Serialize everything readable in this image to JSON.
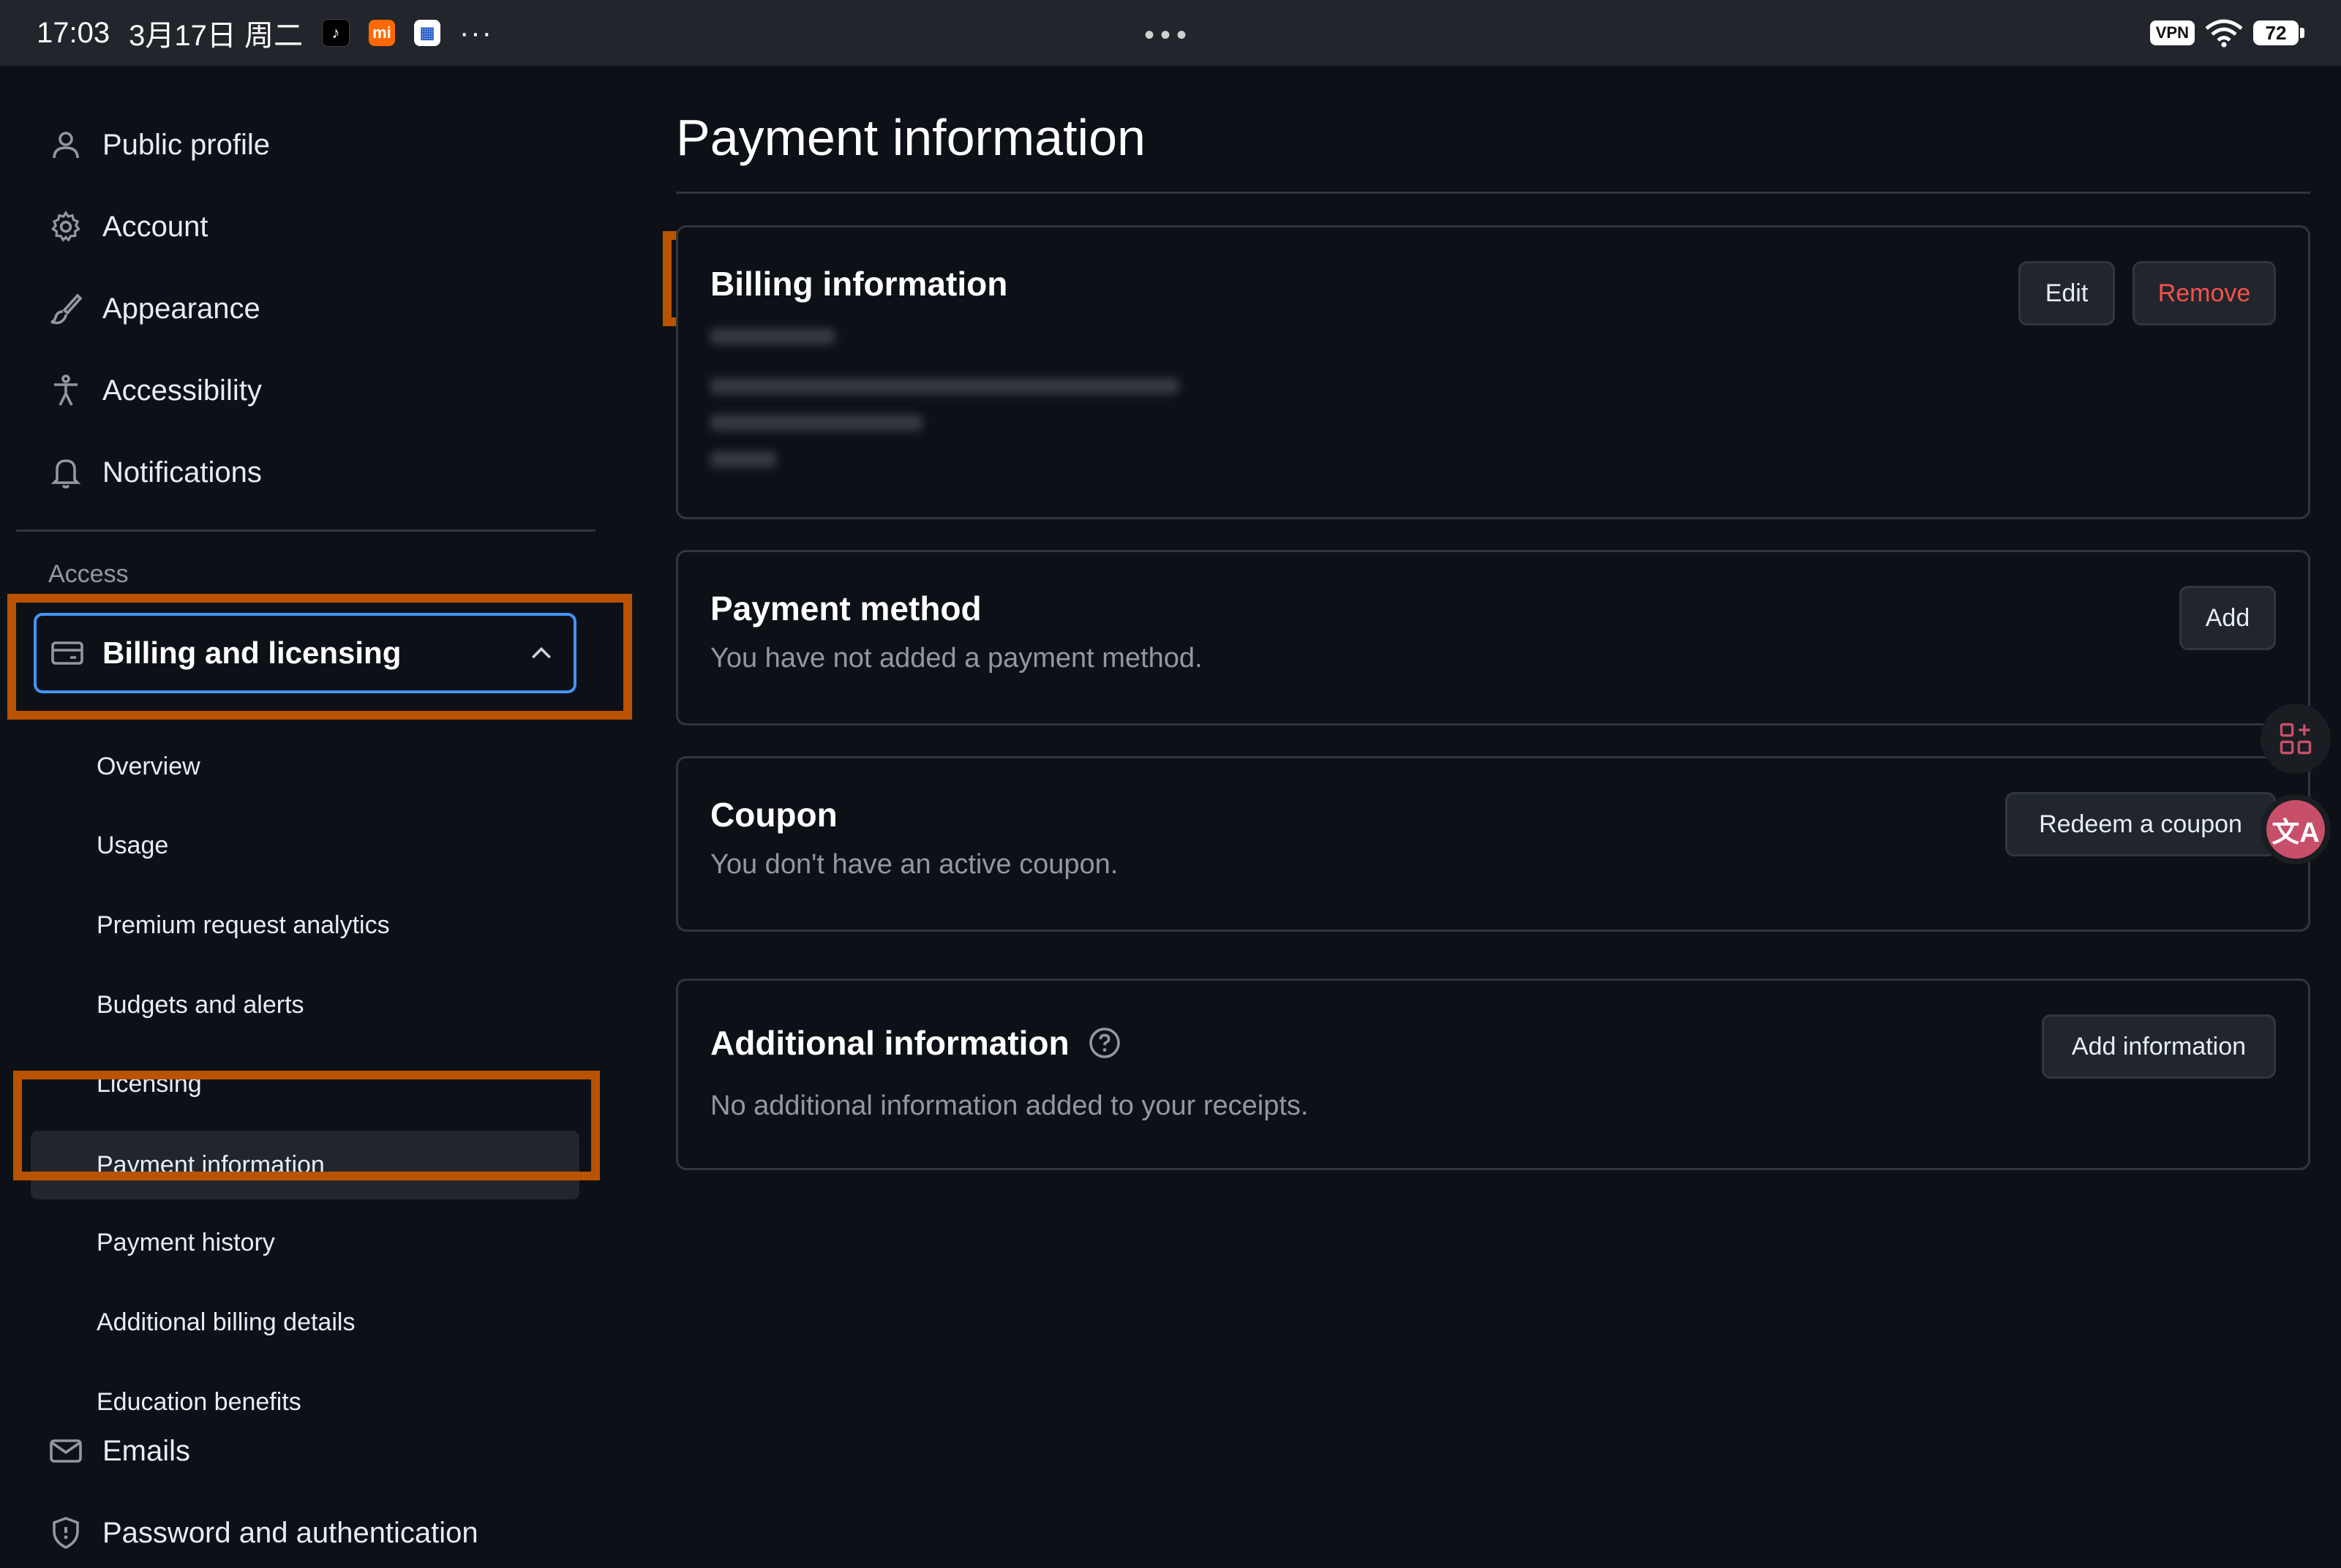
{
  "status_bar": {
    "time": "17:03",
    "date": "3月17日 周二",
    "app_mi_label": "mi",
    "more": "···",
    "center_dots": "•••",
    "vpn": "VPN",
    "battery": "72"
  },
  "sidebar": {
    "items": [
      {
        "label": "Public profile",
        "icon": "person-icon"
      },
      {
        "label": "Account",
        "icon": "gear-icon"
      },
      {
        "label": "Appearance",
        "icon": "paintbrush-icon"
      },
      {
        "label": "Accessibility",
        "icon": "accessibility-icon"
      },
      {
        "label": "Notifications",
        "icon": "bell-icon"
      }
    ],
    "group_label": "Access",
    "billing": {
      "label": "Billing and licensing",
      "icon": "credit-card-icon",
      "expanded": true
    },
    "billing_subitems": [
      {
        "label": "Overview"
      },
      {
        "label": "Usage"
      },
      {
        "label": "Premium request analytics"
      },
      {
        "label": "Budgets and alerts"
      },
      {
        "label": "Licensing"
      },
      {
        "label": "Payment information",
        "active": true
      },
      {
        "label": "Payment history"
      },
      {
        "label": "Additional billing details"
      },
      {
        "label": "Education benefits"
      }
    ],
    "after_items": [
      {
        "label": "Emails",
        "icon": "mail-icon"
      },
      {
        "label": "Password and authentication",
        "icon": "shield-icon"
      }
    ]
  },
  "main": {
    "page_title": "Payment information",
    "billing_card": {
      "title": "Billing information",
      "edit_label": "Edit",
      "remove_label": "Remove"
    },
    "payment_method_card": {
      "title": "Payment method",
      "description": "You have not added a payment method.",
      "add_label": "Add"
    },
    "coupon_card": {
      "title": "Coupon",
      "description": "You don't have an active coupon.",
      "redeem_label": "Redeem a coupon"
    },
    "additional_card": {
      "title": "Additional information",
      "description": "No additional information added to your receipts.",
      "add_label": "Add information"
    }
  },
  "float_tools": {
    "translate_glyph": "文A"
  },
  "colors": {
    "background": "#0d1117",
    "accent_blue": "#4493f8",
    "danger": "#f85149",
    "highlight_orange": "#b95300"
  }
}
